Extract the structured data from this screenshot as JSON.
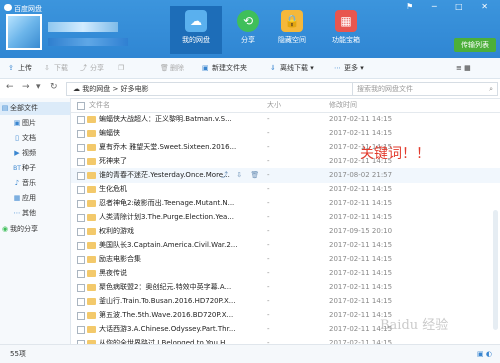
{
  "app": {
    "title": "百度网盘",
    "window_controls": "⚑ ─ □ ✕"
  },
  "tabs": [
    {
      "label": "我的网盘",
      "icon": "cloud-icon",
      "color": "#5ab0ee"
    },
    {
      "label": "分享",
      "icon": "share-icon",
      "color": "#3fbf5a"
    },
    {
      "label": "隐藏空间",
      "icon": "lock-icon",
      "color": "#f5b83a"
    },
    {
      "label": "功能宝箱",
      "icon": "gift-icon",
      "color": "#e8564f"
    }
  ],
  "upgrade_label": "传输列表",
  "toolbar": {
    "upload": "上传",
    "download": "下载",
    "share": "分享",
    "copy": "",
    "delete": "删除",
    "new_folder": "新建文件夹",
    "offline": "离线下载",
    "more": "更多"
  },
  "nav": {
    "path_root": "我的网盘",
    "path_sep": ">",
    "path_current": "好多电影",
    "search_placeholder": "搜索我的网盘文件"
  },
  "sidebar": {
    "items": [
      {
        "label": "全部文件",
        "icon": "folder-icon"
      },
      {
        "label": "图片",
        "icon": "image-icon"
      },
      {
        "label": "文档",
        "icon": "doc-icon"
      },
      {
        "label": "视频",
        "icon": "video-icon"
      },
      {
        "label": "种子",
        "icon": "bt-icon"
      },
      {
        "label": "音乐",
        "icon": "music-icon"
      },
      {
        "label": "应用",
        "icon": "app-icon"
      },
      {
        "label": "其他",
        "icon": "other-icon"
      },
      {
        "label": "我的分享",
        "icon": "share-icon"
      }
    ]
  },
  "columns": {
    "name": "文件名",
    "size": "大小",
    "date": "修改时间"
  },
  "files": [
    {
      "name": "蝙蝠侠大战超人：正义黎明.Batman.v.S...",
      "size": "-",
      "date": "2017-02-11 14:15"
    },
    {
      "name": "蝙蝠侠",
      "size": "-",
      "date": "2017-02-11 14:15"
    },
    {
      "name": "夏有乔木 雅望天堂.Sweet.Sixteen.2016...",
      "size": "-",
      "date": "2017-02-11 14:15"
    },
    {
      "name": "死神来了",
      "size": "-",
      "date": "2017-02-11 14:15"
    },
    {
      "name": "谁的青春不迷茫.Yesterday.Once.More...",
      "size": "-",
      "date": "2017-08-02 21:57"
    },
    {
      "name": "生化危机",
      "size": "-",
      "date": "2017-02-11 14:15"
    },
    {
      "name": "忍者神龟2:破影而出.Teenage.Mutant.N...",
      "size": "-",
      "date": "2017-02-11 14:15"
    },
    {
      "name": "人类清除计划3.The.Purge.Election.Yea...",
      "size": "-",
      "date": "2017-02-11 14:15"
    },
    {
      "name": "权利的游戏",
      "size": "-",
      "date": "2017-09-15 20:10"
    },
    {
      "name": "美国队长3.Captain.America.Civil.War.2...",
      "size": "-",
      "date": "2017-02-11 14:15"
    },
    {
      "name": "励志电影合集",
      "size": "-",
      "date": "2017-02-11 14:15"
    },
    {
      "name": "黑夜传说",
      "size": "-",
      "date": "2017-02-11 14:15"
    },
    {
      "name": "聚色病联盟2：奥创纪元.特效中英字幕.A...",
      "size": "-",
      "date": "2017-02-11 14:15"
    },
    {
      "name": "釜山行.Train.To.Busan.2016.HD720P.X...",
      "size": "-",
      "date": "2017-02-11 14:15"
    },
    {
      "name": "第五波.The.5th.Wave.2016.BD720P.X...",
      "size": "-",
      "date": "2017-02-11 14:15"
    },
    {
      "name": "大话西游3.A.Chinese.Odyssey.Part.Thr...",
      "size": "-",
      "date": "2017-02-11 14:15"
    },
    {
      "name": "从你的全世界路过.I.Belonged.to.You.H...",
      "size": "-",
      "date": "2017-02-11 14:15"
    }
  ],
  "annotation": "关键词！！",
  "status": {
    "count": "55项"
  },
  "watermark": "Baidu 经验"
}
